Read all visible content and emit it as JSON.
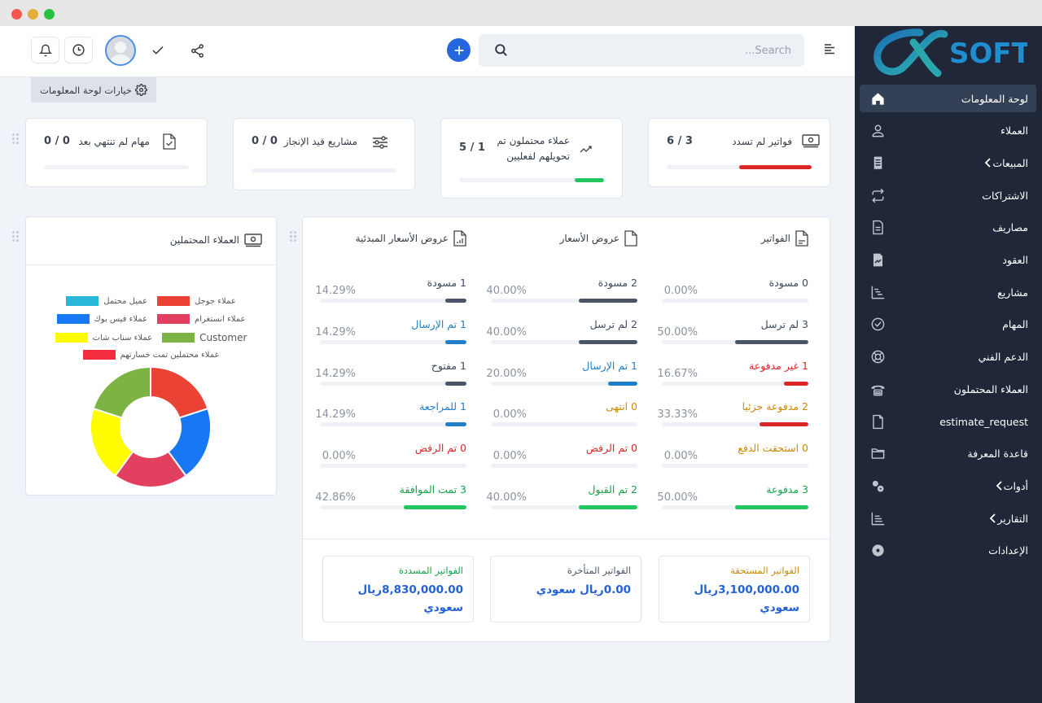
{
  "window": {
    "controls": [
      "close",
      "minimize",
      "maximize"
    ]
  },
  "topbar": {
    "search_placeholder": "...Search",
    "icons": [
      "bell-icon",
      "clock-icon",
      "avatar",
      "check-icon",
      "share-icon",
      "plus-icon",
      "search-icon",
      "menu-icon"
    ]
  },
  "dashboard_options": {
    "label": "خيارات لوحة المعلومات"
  },
  "stats": [
    {
      "title": "فواتير لم تسدد",
      "value": "6 / 3",
      "progress_fraction": 0.5,
      "color": "#dc2626",
      "icon": "money-icon"
    },
    {
      "title": "عملاء محتملون تم تحويلهم لفعليين",
      "value": "5 / 1",
      "progress_fraction": 0.2,
      "color": "#22c55e",
      "icon": "trend-icon"
    },
    {
      "title": "مشاريع قيد الإنجاز",
      "value": "0 / 0",
      "progress_fraction": 0,
      "color": "#3c4450",
      "icon": "sliders-icon"
    },
    {
      "title": "مهام لم تنتهي بعد",
      "value": "0 / 0",
      "progress_fraction": 0,
      "color": "#3c4450",
      "icon": "file-check-icon"
    }
  ],
  "leads_chart": {
    "title": "العملاء المحتملين",
    "chart_data": {
      "type": "pie",
      "title": "العملاء المحتملين",
      "legend_position": "top",
      "series": [
        {
          "name": "عملاء جوجل",
          "value": 1,
          "color": "#ea4335"
        },
        {
          "name": "عميل محتمل",
          "value": 0,
          "color": "#29b6d8"
        },
        {
          "name": "عملاء انستغرام",
          "value": 1,
          "color": "#e1415f"
        },
        {
          "name": "عملاء فيس بوك",
          "value": 1,
          "color": "#1877f2"
        },
        {
          "name": "Customer",
          "value": 1,
          "color": "#7cb342"
        },
        {
          "name": "عملاء سناب شات",
          "value": 1,
          "color": "#fffc00"
        },
        {
          "name": "عملاء محتملين تمت خسارتهم",
          "value": 0,
          "color": "#f22d3d"
        }
      ],
      "slice_order": [
        "عملاء جوجل",
        "عملاء فيس بوك",
        "عملاء انستغرام",
        "عملاء سناب شات",
        "Customer"
      ]
    }
  },
  "overview": {
    "columns": [
      {
        "title": "الفواتير",
        "icon": "invoice-icon",
        "rows": [
          {
            "count": "0",
            "label": "مسودة",
            "pct": "0.00%",
            "fraction": 0,
            "color": "#3f4a5c",
            "text_color": "#3f4a5c"
          },
          {
            "count": "3",
            "label": "لم ترسل",
            "pct": "50.00%",
            "fraction": 0.5,
            "color": "#4a5568",
            "text_color": "#3f4a5c"
          },
          {
            "count": "1",
            "label": "غير مدفوعة",
            "pct": "16.67%",
            "fraction": 0.1667,
            "color": "#dc2626",
            "text_color": "#dc2626"
          },
          {
            "count": "2",
            "label": "مدفوعة جزئيا",
            "pct": "33.33%",
            "fraction": 0.3333,
            "color": "#dc2626",
            "text_color": "#ca8a04"
          },
          {
            "count": "0",
            "label": "استحقت الدفع",
            "pct": "0.00%",
            "fraction": 0,
            "color": "#ca8a04",
            "text_color": "#ca8a04"
          },
          {
            "count": "3",
            "label": "مدفوعة",
            "pct": "50.00%",
            "fraction": 0.5,
            "color": "#22c55e",
            "text_color": "#16a34a"
          }
        ]
      },
      {
        "title": "عروض الأسعار",
        "icon": "file-icon",
        "rows": [
          {
            "count": "2",
            "label": "مسودة",
            "pct": "40.00%",
            "fraction": 0.4,
            "color": "#4a5568",
            "text_color": "#3f4a5c"
          },
          {
            "count": "2",
            "label": "لم ترسل",
            "pct": "40.00%",
            "fraction": 0.4,
            "color": "#4a5568",
            "text_color": "#3f4a5c"
          },
          {
            "count": "1",
            "label": "تم الإرسال",
            "pct": "20.00%",
            "fraction": 0.2,
            "color": "#1e7fc8",
            "text_color": "#1e7fc8"
          },
          {
            "count": "0",
            "label": "انتهى",
            "pct": "0.00%",
            "fraction": 0,
            "color": "#ca8a04",
            "text_color": "#ca8a04"
          },
          {
            "count": "0",
            "label": "تم الرفض",
            "pct": "0.00%",
            "fraction": 0,
            "color": "#dc2626",
            "text_color": "#dc2626"
          },
          {
            "count": "2",
            "label": "تم القبول",
            "pct": "40.00%",
            "fraction": 0.4,
            "color": "#22c55e",
            "text_color": "#16a34a"
          }
        ]
      },
      {
        "title": "عروض الأسعار المبدئية",
        "icon": "file-chart-icon",
        "rows": [
          {
            "count": "1",
            "label": "مسودة",
            "pct": "14.29%",
            "fraction": 0.1429,
            "color": "#4a5568",
            "text_color": "#3f4a5c"
          },
          {
            "count": "1",
            "label": "تم الإرسال",
            "pct": "14.29%",
            "fraction": 0.1429,
            "color": "#1e7fc8",
            "text_color": "#1e7fc8"
          },
          {
            "count": "1",
            "label": "مفتوح",
            "pct": "14.29%",
            "fraction": 0.1429,
            "color": "#4a5568",
            "text_color": "#3f4a5c"
          },
          {
            "count": "1",
            "label": "للمراجعة",
            "pct": "14.29%",
            "fraction": 0.1429,
            "color": "#1e7fc8",
            "text_color": "#1e7fc8"
          },
          {
            "count": "0",
            "label": "تم الرفض",
            "pct": "0.00%",
            "fraction": 0,
            "color": "#dc2626",
            "text_color": "#dc2626"
          },
          {
            "count": "3",
            "label": "تمت الموافقة",
            "pct": "42.86%",
            "fraction": 0.4286,
            "color": "#22c55e",
            "text_color": "#16a34a"
          }
        ]
      }
    ],
    "summaries": [
      {
        "title": "الفواتير المستحقة",
        "value": "3,100,000.00ريال سعودي",
        "title_color": "#ca8a04"
      },
      {
        "title": "الفواتير المتأخرة",
        "value": "0.00ريال سعودي",
        "title_color": "#4a5568"
      },
      {
        "title": "الفواتير المسددة",
        "value": "8,830,000.00ريال سعودي",
        "title_color": "#16a34a"
      }
    ]
  },
  "sidebar": {
    "logo_text": "SOFT",
    "items": [
      {
        "label": "لوحة المعلومات",
        "icon": "home-icon",
        "active": true,
        "submenu": false
      },
      {
        "label": "العملاء",
        "icon": "user-icon",
        "active": false,
        "submenu": false
      },
      {
        "label": "المبيعات",
        "icon": "receipt-icon",
        "active": false,
        "submenu": true
      },
      {
        "label": "الاشتراكات",
        "icon": "repeat-icon",
        "active": false,
        "submenu": false
      },
      {
        "label": "مصاريف",
        "icon": "file-text-icon",
        "active": false,
        "submenu": false
      },
      {
        "label": "العقود",
        "icon": "contract-icon",
        "active": false,
        "submenu": false
      },
      {
        "label": "مشاريع",
        "icon": "gantt-icon",
        "active": false,
        "submenu": false
      },
      {
        "label": "المهام",
        "icon": "check-circle-icon",
        "active": false,
        "submenu": false
      },
      {
        "label": "الدعم الفني",
        "icon": "lifebuoy-icon",
        "active": false,
        "submenu": false
      },
      {
        "label": "العملاء المحتملون",
        "icon": "phone-icon",
        "active": false,
        "submenu": false
      },
      {
        "label": "estimate_request",
        "icon": "document-icon",
        "active": false,
        "submenu": false
      },
      {
        "label": "قاعدة المعرفة",
        "icon": "folder-icon",
        "active": false,
        "submenu": false
      },
      {
        "label": "أدوات",
        "icon": "cogs-icon",
        "active": false,
        "submenu": true
      },
      {
        "label": "التقارير",
        "icon": "bar-chart-icon",
        "active": false,
        "submenu": true
      },
      {
        "label": "الإعدادات",
        "icon": "settings-icon",
        "active": false,
        "submenu": false
      }
    ]
  }
}
